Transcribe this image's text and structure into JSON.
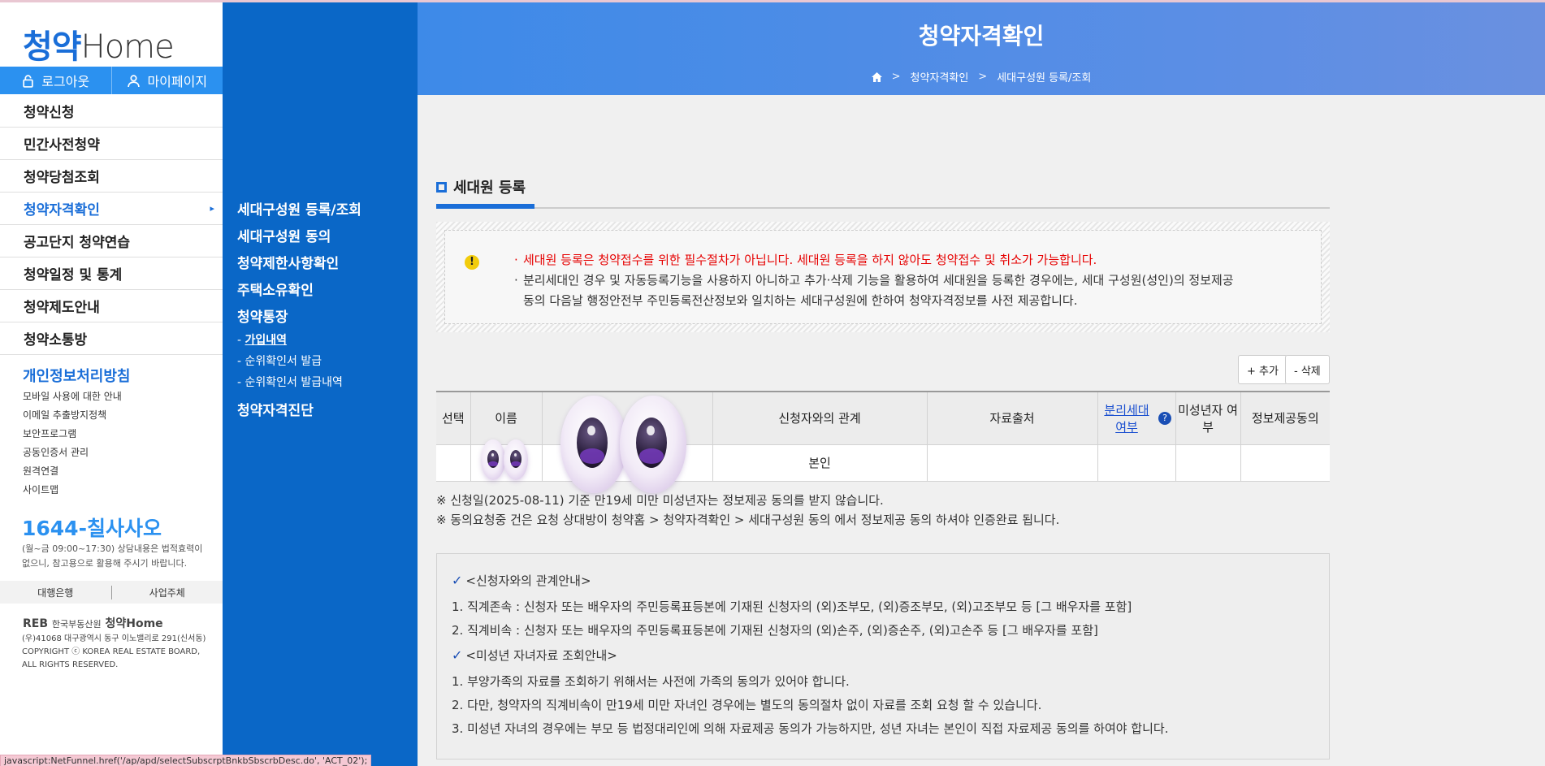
{
  "sidebar": {
    "logo_ko": "청약",
    "logo_en": "Home",
    "logout_label": "로그아웃",
    "mypage_label": "마이페이지",
    "menu": [
      {
        "label": "청약신청"
      },
      {
        "label": "민간사전청약"
      },
      {
        "label": "청약당첨조회"
      },
      {
        "label": "청약자격확인"
      },
      {
        "label": "공고단지 청약연습"
      },
      {
        "label": "청약일정 및 통계"
      },
      {
        "label": "청약제도안내"
      },
      {
        "label": "청약소통방"
      }
    ],
    "active_menu": "청약자격확인",
    "privacy_title": "개인정보처리방침",
    "links": [
      "모바일 사용에 대한 안내",
      "이메일 추출방지정책",
      "보안프로그램",
      "공동인증서 관리",
      "원격연결",
      "사이트맵"
    ],
    "phone_prefix": "1644-",
    "phone_suffix": "칠사사오",
    "phone_note": "(월~금 09:00~17:30) 상담내용은 법적효력이 없으니, 참고용으로 활용해 주시기 바랍니다.",
    "bank_label": "대행은행",
    "business_label": "사업주체",
    "reb_label": "REB",
    "reb_org": "한국부동산원",
    "reb_home": "청약Home",
    "address": "(우)41068 대구광역시 동구 이노밸리로 291(신서동)",
    "copyright": "COPYRIGHT ⓒ KOREA REAL ESTATE BOARD, ALL RIGHTS RESERVED.",
    "status_url": "javascript:NetFunnel.href('/ap/apd/selectSubscrptBnkbSbscrbDesc.do', 'ACT_02');"
  },
  "submenu": {
    "items": [
      "세대구성원 등록/조회",
      "세대구성원 동의",
      "청약제한사항확인",
      "주택소유확인",
      "청약통장"
    ],
    "bankbook_sub": [
      "가입내역",
      "순위확인서 발급",
      "순위확인서 발급내역"
    ],
    "diagnosis": "청약자격진단"
  },
  "header": {
    "title": "청약자격확인",
    "breadcrumb": [
      "청약자격확인",
      "세대구성원 등록/조회"
    ]
  },
  "section": {
    "title": "세대원 등록",
    "notice_red": "세대원 등록은 청약접수를 위한 필수절차가 아닙니다. 세대원 등록을 하지 않아도 청약접수 및 취소가 가능합니다.",
    "notice_2a": "분리세대인 경우 및 자동등록기능을 사용하지 아니하고 추가·삭제 기능을 활용하여 세대원을 등록한 경우에는, 세대 구성원(성인)의 정보제공",
    "notice_2b": "동의 다음날 행정안전부 주민등록전산정보와 일치하는 세대구성원에 한하여 청약자격정보를 사전 제공합니다."
  },
  "buttons": {
    "add": "+ 추가",
    "delete": "- 삭제"
  },
  "table": {
    "headers": [
      "선택",
      "이름",
      "",
      "신청자와의 관계",
      "자료출처",
      "분리세대 여부",
      "미성년자 여부",
      "정보제공동의"
    ],
    "rows": [
      [
        "",
        "",
        "",
        "본인",
        "",
        "",
        "",
        ""
      ]
    ]
  },
  "notes": [
    "※ 신청일(2025-08-11) 기준 만19세 미만 미성년자는 정보제공 동의를 받지 않습니다.",
    "※ 동의요청중 건은 요청 상대방이 청약홈 > 청약자격확인 > 세대구성원 동의 에서 정보제공 동의 하셔야 인증완료 됩니다."
  ],
  "guide": {
    "rel_title": "<신청자와의 관계안내>",
    "rel_lines": [
      "1. 직계존속 : 신청자 또는 배우자의 주민등록표등본에 기재된 신청자의 (외)조부모, (외)증조부모, (외)고조부모 등 [그 배우자를 포함]",
      "2. 직계비속 : 신청자 또는 배우자의 주민등록표등본에 기재된 신청자의 (외)손주, (외)증손주, (외)고손주 등 [그 배우자를 포함]"
    ],
    "minor_title": "<미성년 자녀자료 조회안내>",
    "minor_lines": [
      "1. 부양가족의 자료를 조회하기 위해서는 사전에 가족의 동의가 있어야 합니다.",
      "2. 다만, 청약자의 직계비속이 만19세 미만 자녀인 경우에는 별도의 동의절차 없이 자료를 조회 요청 할 수 있습니다.",
      "3. 미성년 자녀의 경우에는 부모 등 법정대리인에 의해 자료제공 동의가 가능하지만, 성년 자녀는 본인이 직접 자료제공 동의를 하여야 합니다."
    ]
  }
}
